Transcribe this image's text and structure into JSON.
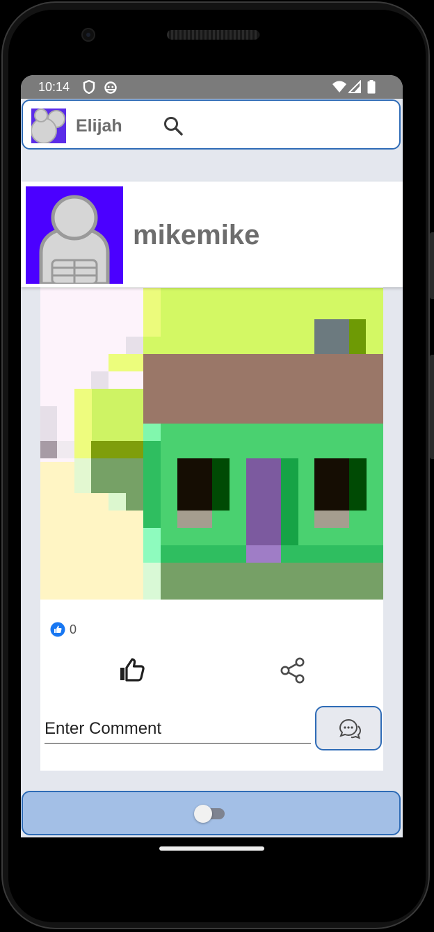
{
  "status_bar": {
    "time": "10:14",
    "icons": [
      "shield-icon",
      "android-icon",
      "wifi-icon",
      "signal-icon",
      "battery-icon"
    ]
  },
  "app_bar": {
    "user_name": "Elijah",
    "avatar_icon": "group-avatar-icon",
    "search_icon": "search-icon"
  },
  "post": {
    "author": "mikemike",
    "author_avatar_icon": "person-avatar-icon",
    "like_count": "0",
    "like_badge_icon": "thumbs-up-badge-icon",
    "like_button_icon": "thumbs-up-icon",
    "share_button_icon": "share-icon",
    "comment_placeholder": "Enter Comment",
    "comment_send_icon": "chat-bubbles-icon"
  },
  "bottom_bar": {
    "toggle_icon": "toggle-switch-icon",
    "toggle_on": false
  },
  "colors": {
    "accent": "#2e6bb6",
    "bottom_bar": "#a3bfe6",
    "avatar_bg": "#4b00ff",
    "screen_bg": "#e4e7ee"
  }
}
